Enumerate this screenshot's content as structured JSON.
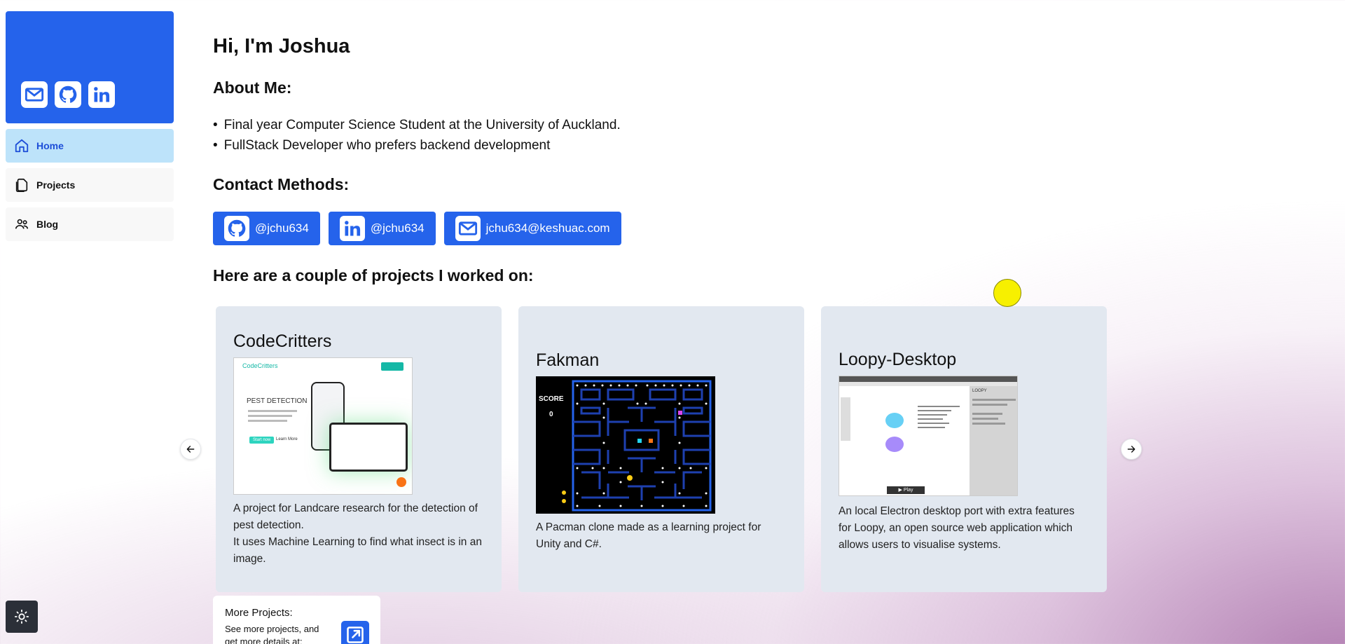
{
  "sidebar": {
    "nav": [
      {
        "label": "Home",
        "icon": "home-icon",
        "active": true
      },
      {
        "label": "Projects",
        "icon": "projects-icon",
        "active": false
      },
      {
        "label": "Blog",
        "icon": "blog-icon",
        "active": false
      }
    ]
  },
  "main": {
    "greeting": "Hi, I'm Joshua",
    "about_title": "About Me:",
    "about_items": [
      "Final year Computer Science Student at the University of Auckland.",
      "FullStack Developer who prefers backend development"
    ],
    "contact_title": "Contact Methods:",
    "contacts": [
      {
        "icon": "github-icon",
        "label": "@jchu634"
      },
      {
        "icon": "linkedin-icon",
        "label": "@jchu634"
      },
      {
        "icon": "mail-icon",
        "label": "jchu634@keshuac.com"
      }
    ],
    "projects_title": "Here are a couple of projects I worked on:",
    "projects": [
      {
        "title": "CodeCritters",
        "desc_lines": [
          "A project for Landcare research for the detection of pest detection.",
          "It uses Machine Learning to find what insect is in an image."
        ],
        "image_text": {
          "brand": "CodeCritters",
          "heading": "PEST DETECTION",
          "button": "Start now",
          "link": "Learn More"
        }
      },
      {
        "title": "Fakman",
        "desc_lines": [
          "A Pacman clone made as a learning project for Unity and C#."
        ],
        "image_text": {
          "score_label": "SCORE",
          "score_value": "0"
        }
      },
      {
        "title": "Loopy-Desktop",
        "desc_lines": [
          "An local Electron desktop port with extra features for Loopy, an open source web application which allows users to visualise systems."
        ],
        "image_text": {
          "brand": "LOOPY",
          "play": "▶ Play"
        }
      }
    ],
    "more": {
      "title": "More Projects:",
      "desc": "See more projects, and get more details at:"
    }
  },
  "colors": {
    "accent": "#2563eb",
    "active_nav_bg": "#bde3fa",
    "card_bg": "#e2e8f0"
  }
}
